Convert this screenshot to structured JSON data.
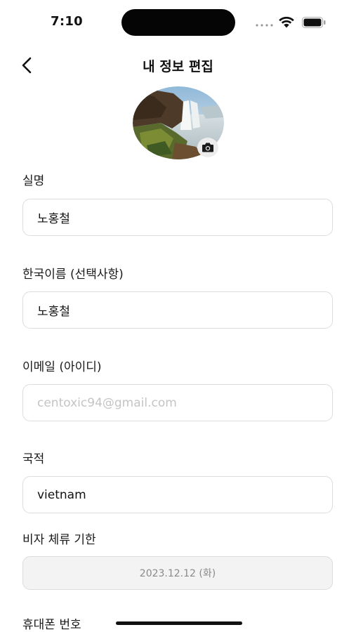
{
  "status_bar": {
    "time": "7:10"
  },
  "nav": {
    "title": "내 정보 편집"
  },
  "form": {
    "real_name": {
      "label": "실명",
      "value": "노홍철"
    },
    "korean_name": {
      "label": "한국이름 (선택사항)",
      "value": "노홍철"
    },
    "email": {
      "label": "이메일 (아이디)",
      "placeholder": "centoxic94@gmail.com"
    },
    "nationality": {
      "label": "국적",
      "value": "vietnam"
    },
    "visa_expiry": {
      "label": "비자 체류 기한",
      "value": "2023.12.12 (화)"
    },
    "phone": {
      "label": "휴대폰 번호"
    }
  },
  "icons": {
    "back": "chevron-left-icon",
    "camera": "camera-icon",
    "wifi": "wifi-icon",
    "battery": "battery-icon"
  }
}
